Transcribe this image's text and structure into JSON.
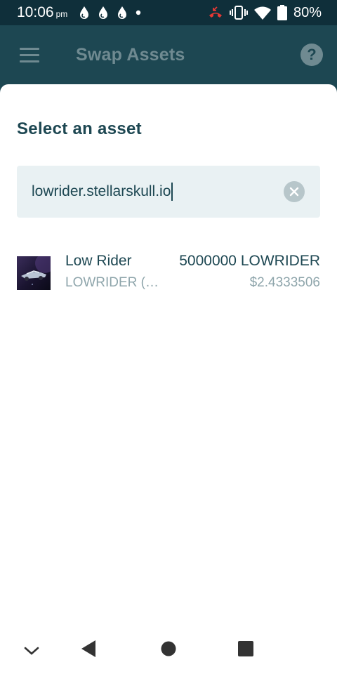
{
  "status_bar": {
    "time": "10:06",
    "ampm": "pm",
    "battery_percent": "80%",
    "left_icons": [
      "water-drop-icon",
      "water-drop-icon",
      "water-drop-icon",
      "dot-icon"
    ],
    "right_icons": [
      "missed-call-icon",
      "vibrate-icon",
      "wifi-icon",
      "battery-icon"
    ]
  },
  "app_bar": {
    "title": "Swap Assets",
    "menu_icon": "hamburger-menu-icon",
    "help_icon": "help-icon",
    "help_glyph": "?"
  },
  "sheet": {
    "title": "Select an asset",
    "search": {
      "value": "lowrider.stellarskull.io",
      "clear_icon": "clear-icon"
    },
    "results": [
      {
        "name": "Low Rider",
        "code": "LOWRIDER (…",
        "amount": "5000000 LOWRIDER",
        "usd_value": "$2.4333506"
      }
    ]
  },
  "nav_bar": {
    "items": [
      "collapse-chevron-icon",
      "back-icon",
      "home-icon",
      "recents-icon"
    ]
  },
  "colors": {
    "primary_dark": "#0f2f3a",
    "primary": "#1d4752",
    "muted_text": "#8ea5ab",
    "search_bg": "#e9f1f3"
  }
}
